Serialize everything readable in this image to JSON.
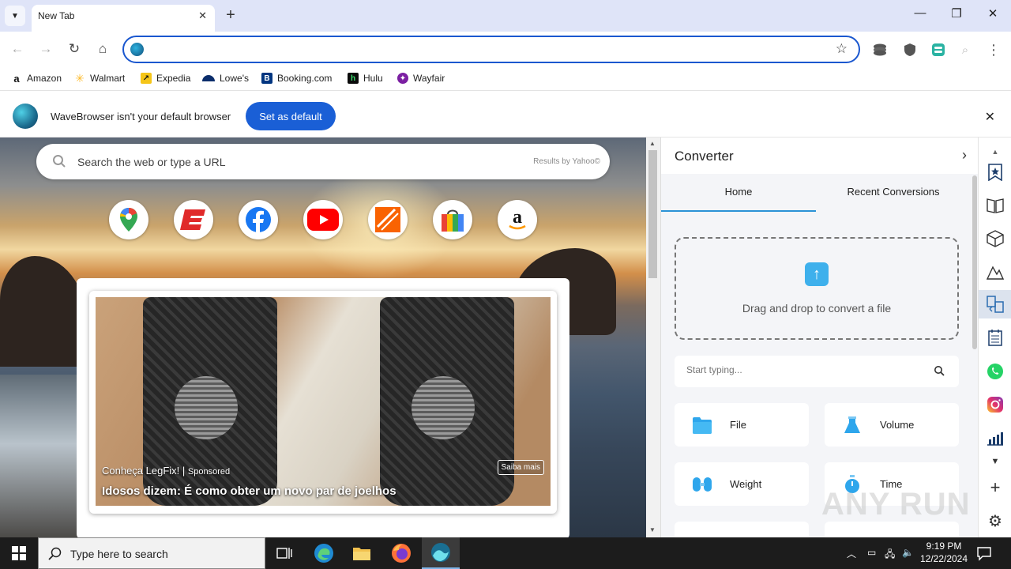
{
  "browser": {
    "tab_title": "New Tab",
    "omnibox_value": "",
    "bookmarks": [
      {
        "label": "Amazon",
        "icon": "amazon-icon",
        "color": "#111111"
      },
      {
        "label": "Walmart",
        "icon": "walmart-icon",
        "color": "#fdbb2d"
      },
      {
        "label": "Expedia",
        "icon": "expedia-icon",
        "color": "#f5c518"
      },
      {
        "label": "Lowe's",
        "icon": "lowes-icon",
        "color": "#0b2d6b"
      },
      {
        "label": "Booking.com",
        "icon": "booking-icon",
        "color": "#003580"
      },
      {
        "label": "Hulu",
        "icon": "hulu-icon",
        "color": "#0b0b0b"
      },
      {
        "label": "Wayfair",
        "icon": "wayfair-icon",
        "color": "#7b1fa2"
      }
    ]
  },
  "infobar": {
    "message": "WaveBrowser isn't your default browser",
    "button": "Set as default"
  },
  "newtab": {
    "search_placeholder": "Search the web or type a URL",
    "results_by": "Results by Yahoo©",
    "shortcuts": [
      "google-maps-icon",
      "espn-icon",
      "facebook-icon",
      "youtube-icon",
      "home-depot-icon",
      "shopping-bag-icon",
      "amazon-icon"
    ],
    "ad": {
      "brand": "Conheça LegFix!",
      "sponsored": "Sponsored",
      "headline": "Idosos dizem: É como obter um novo par de joelhos",
      "cta": "Saiba mais"
    }
  },
  "converter": {
    "title": "Converter",
    "tabs": [
      "Home",
      "Recent Conversions"
    ],
    "active_tab": "Home",
    "drop_text": "Drag and drop to convert a file",
    "search_placeholder": "Start typing...",
    "categories": [
      {
        "label": "File",
        "icon": "folder-icon"
      },
      {
        "label": "Volume",
        "icon": "flask-icon"
      },
      {
        "label": "Weight",
        "icon": "weight-icon"
      },
      {
        "label": "Time",
        "icon": "stopwatch-icon"
      }
    ],
    "accent": "#2b93d6"
  },
  "taskbar": {
    "search_placeholder": "Type here to search",
    "time": "9:19 PM",
    "date": "12/22/2024"
  },
  "watermark": "ANY RUN"
}
